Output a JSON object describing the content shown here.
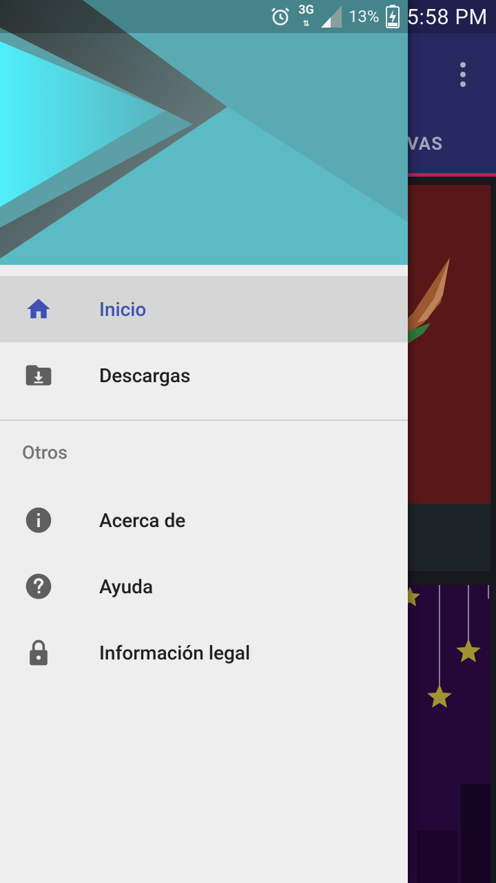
{
  "status_bar": {
    "network": "3G",
    "battery_percent": "13%",
    "time": "5:58 PM",
    "icons": [
      "alarm-icon",
      "network-3g-icon",
      "signal-icon",
      "battery-charging-icon"
    ]
  },
  "app": {
    "visible_tab_fragment": "EVAS",
    "colors": {
      "toolbar": "#2b2f6e",
      "tab_indicator": "#d4236b"
    }
  },
  "drawer": {
    "header_colors": {
      "main": "#5cb9c2",
      "accent": "#4ff0fb",
      "shadow": "#555555"
    },
    "items": [
      {
        "label": "Inicio",
        "icon": "home-icon",
        "active": true
      },
      {
        "label": "Descargas",
        "icon": "folder-download-icon",
        "active": false
      }
    ],
    "section_title": "Otros",
    "other_items": [
      {
        "label": "Acerca de",
        "icon": "info-icon"
      },
      {
        "label": "Ayuda",
        "icon": "help-icon"
      },
      {
        "label": "Información legal",
        "icon": "lock-icon"
      }
    ],
    "colors": {
      "active_text": "#3f51b5",
      "active_bg": "#d6d6d6",
      "text": "#212121",
      "icon": "#5f5f5f"
    }
  }
}
